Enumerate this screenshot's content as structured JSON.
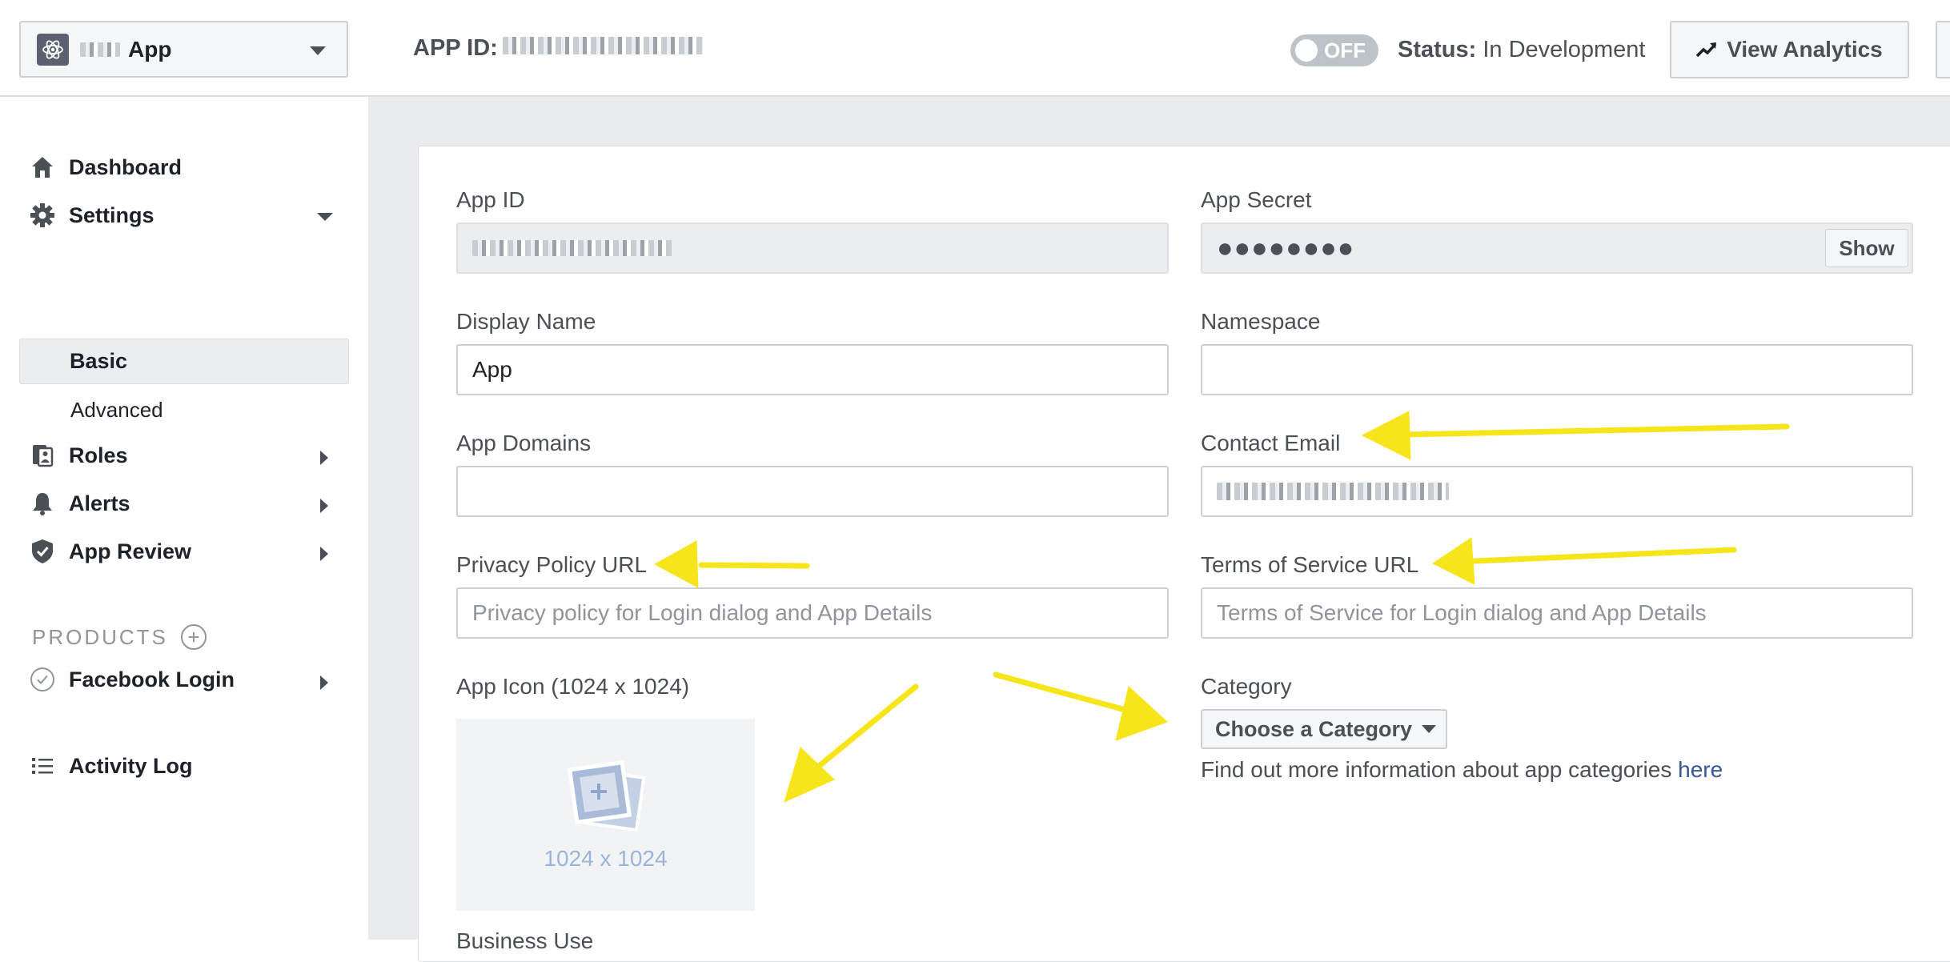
{
  "header": {
    "app_name": "App",
    "app_id_label": "APP ID:",
    "toggle_label": "OFF",
    "status_label": "Status:",
    "status_value": "In Development",
    "analytics_button": "View Analytics"
  },
  "sidebar": {
    "items": [
      {
        "label": "Dashboard",
        "icon": "home-icon"
      },
      {
        "label": "Settings",
        "icon": "gear-icon"
      },
      {
        "label": "Basic"
      },
      {
        "label": "Advanced"
      },
      {
        "label": "Roles",
        "icon": "roles-icon"
      },
      {
        "label": "Alerts",
        "icon": "bell-icon"
      },
      {
        "label": "App Review",
        "icon": "shield-icon"
      }
    ],
    "products_heading": "PRODUCTS",
    "products_add": "+",
    "product_items": [
      {
        "label": "Facebook Login",
        "icon": "check-circle-icon"
      }
    ],
    "activity_log": "Activity Log"
  },
  "form": {
    "app_id_label": "App ID",
    "app_secret_label": "App Secret",
    "app_secret_value": "●●●●●●●●",
    "show_button": "Show",
    "display_name_label": "Display Name",
    "display_name_value": "App",
    "namespace_label": "Namespace",
    "namespace_value": "",
    "app_domains_label": "App Domains",
    "app_domains_value": "",
    "contact_email_label": "Contact Email",
    "privacy_label": "Privacy Policy URL",
    "privacy_placeholder": "Privacy policy for Login dialog and App Details",
    "tos_label": "Terms of Service URL",
    "tos_placeholder": "Terms of Service for Login dialog and App Details",
    "app_icon_label": "App Icon (1024 x 1024)",
    "app_icon_dims": "1024 x 1024",
    "category_label": "Category",
    "category_button": "Choose a Category",
    "category_info": "Find out more information about app categories ",
    "category_link": "here",
    "business_use_label": "Business Use"
  },
  "colors": {
    "annotation_arrow": "#f7e51b",
    "link": "#365899",
    "page_bg": "#e9ebee"
  }
}
